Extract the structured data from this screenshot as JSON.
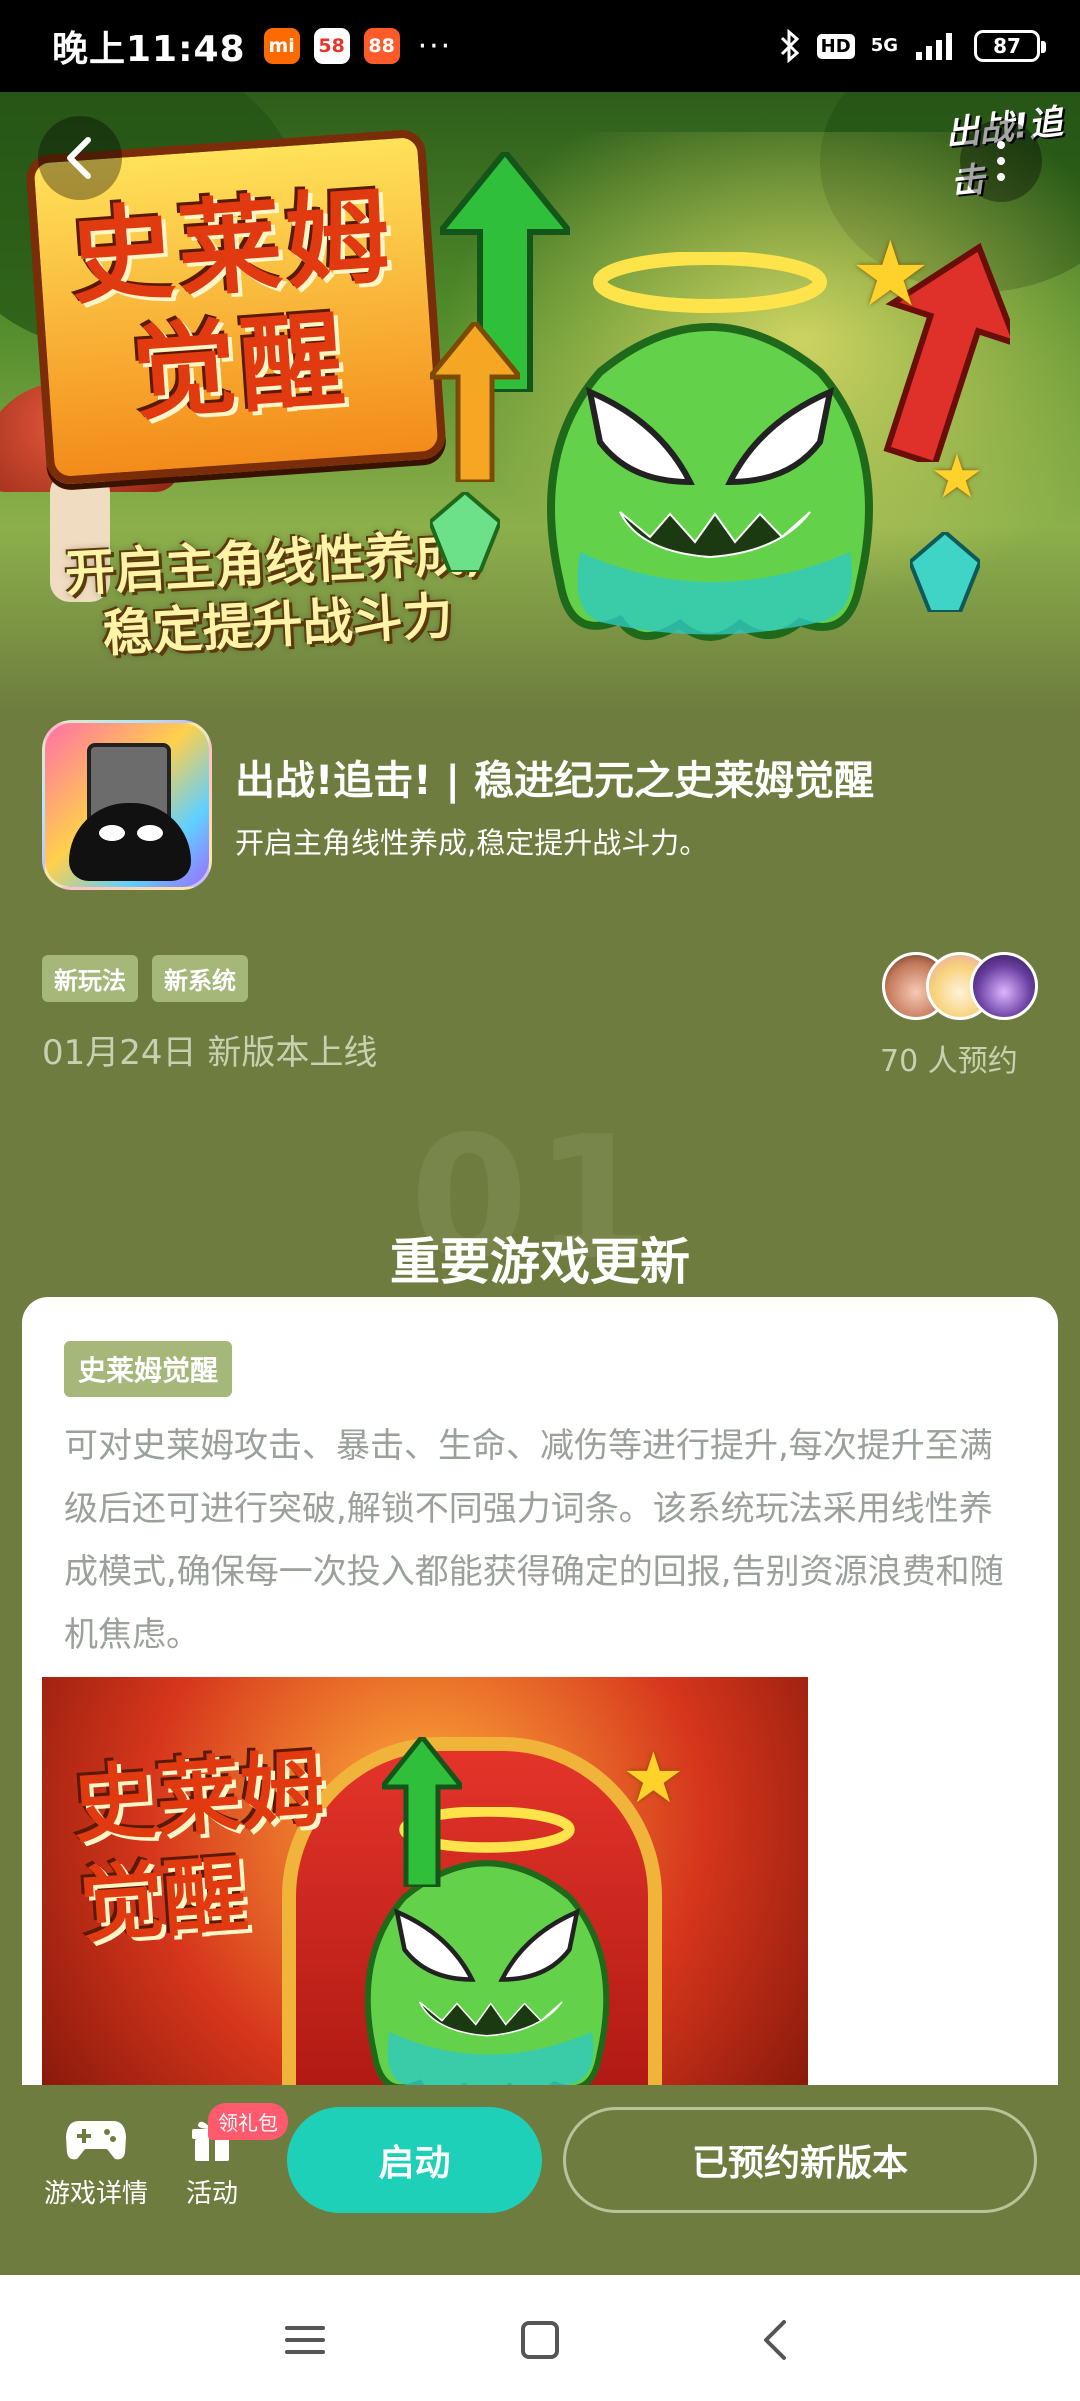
{
  "status_bar": {
    "time": "晚上11:48",
    "apps": [
      {
        "icon": "mi-icon",
        "text": "mi",
        "color": "#ff6a00"
      },
      {
        "icon": "58-icon",
        "text": "58",
        "color": "#ffffff"
      },
      {
        "icon": "app-88-icon",
        "text": "88",
        "color": "#ff5a2a"
      }
    ],
    "more": "···",
    "hd": "HD",
    "network": "5G",
    "battery": "87"
  },
  "banner": {
    "title_line1": "史莱姆",
    "title_line2": "觉醒",
    "subtitle_line1": "开启主角线性养成,",
    "subtitle_line2": "稳定提升战斗力",
    "corner_logo": "出战!追击"
  },
  "game": {
    "title": "出战!追击! | 稳进纪元之史莱姆觉醒",
    "subtitle": "开启主角线性养成,稳定提升战斗力。",
    "tags": [
      "新玩法",
      "新系统"
    ],
    "release": "01月24日 新版本上线",
    "reserve_count": "70 人预约"
  },
  "section": {
    "number": "01",
    "title": "重要游戏更新"
  },
  "card": {
    "tag": "史莱姆觉醒",
    "text": "可对史莱姆攻击、暴击、生命、减伤等进行提升,每次提升至满级后还可进行突破,解锁不同强力词条。该系统玩法采用线性养成模式,确保每一次投入都能获得确定的回报,告别资源浪费和随机焦虑。",
    "image_title_line1": "史莱姆",
    "image_title_line2": "觉醒"
  },
  "action_bar": {
    "details_label": "游戏详情",
    "activity_label": "活动",
    "gift_badge": "领礼包",
    "launch_label": "启动",
    "reserved_label": "已预约新版本"
  },
  "colors": {
    "background": "#6e7d3f",
    "accent": "#1fd0b9",
    "tag": "#a6b77a",
    "badge": "#ff5a6e"
  }
}
